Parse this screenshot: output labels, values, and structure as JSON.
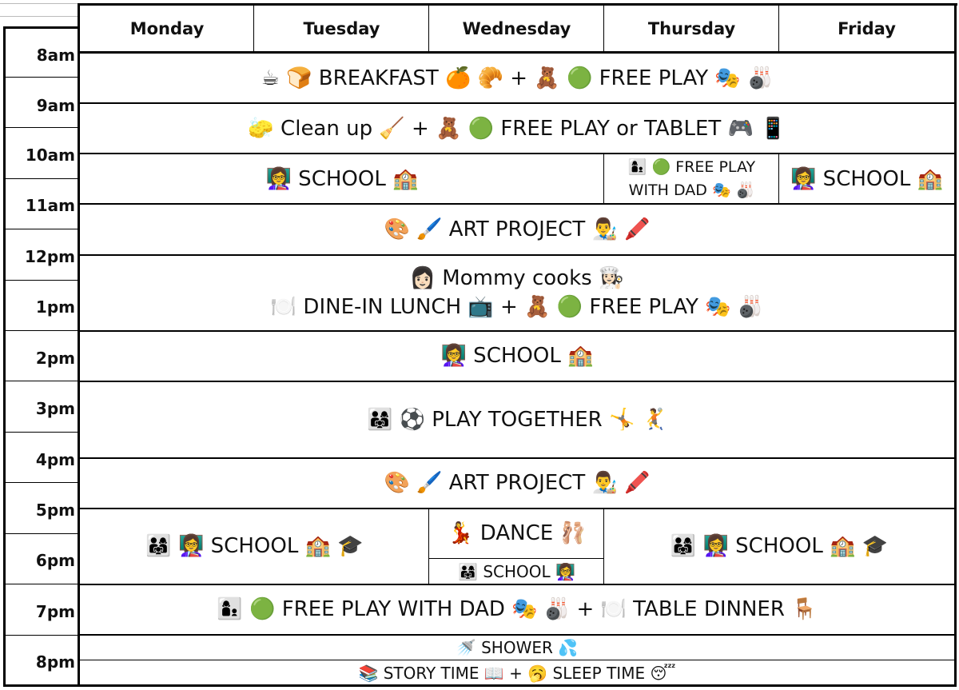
{
  "days": [
    "Monday",
    "Tuesday",
    "Wednesday",
    "Thursday",
    "Friday"
  ],
  "times": [
    "8am",
    "9am",
    "10am",
    "11am",
    "12pm",
    "1pm",
    "2pm",
    "3pm",
    "4pm",
    "5pm",
    "6pm",
    "7pm",
    "8pm"
  ],
  "schedule": {
    "breakfast": "☕ 🍞  BREAKFAST  🍊 🥐     +     🧸 🟢  FREE PLAY  🎭 🎳",
    "cleanup": "🧽  Clean up  🧹     +     🧸 🟢  FREE PLAY or TABLET  🎮 📱",
    "school_mon_wed": "👩‍🏫  SCHOOL  🏫",
    "free_play_dad_line1": "👩‍👦 🟢   FREE PLAY",
    "free_play_dad_line2": "WITH DAD  🎭 🎳",
    "school_fri": "👩‍🏫  SCHOOL  🏫",
    "art_project_am": "🎨 🖌️  ART PROJECT  👨‍🎨 🖍️",
    "mommy_cooks": "👩🏻  Mommy cooks  👩🏻‍🍳",
    "lunch": "🍽️  DINE-IN LUNCH  📺     +     🧸 🟢  FREE PLAY  🎭 🎳",
    "school_afternoon": "👩‍🏫  SCHOOL  🏫",
    "play_together": "👨‍👩‍👧 ⚽  PLAY TOGETHER  🤸 🤾",
    "art_project_pm": "🎨 🖌️  ART PROJECT  👨‍🎨 🖍️",
    "school_mon_tue": "👨‍👩‍👧 👩‍🏫  SCHOOL  🏫 🎓",
    "dance": "💃  DANCE  🩰",
    "school_wed_small": "👨‍👩‍👧   SCHOOL  👩‍🏫",
    "school_thu_fri": "👨‍👩‍👧 👩‍🏫  SCHOOL  🏫 🎓",
    "evening": "👩‍👦 🟢  FREE PLAY WITH DAD  🎭 🎳     +     🍽️  TABLE DINNER  🪑",
    "shower": "🚿  SHOWER  💦",
    "bedtime": "📚  STORY TIME  📖     +     🥱  SLEEP TIME  😴"
  }
}
